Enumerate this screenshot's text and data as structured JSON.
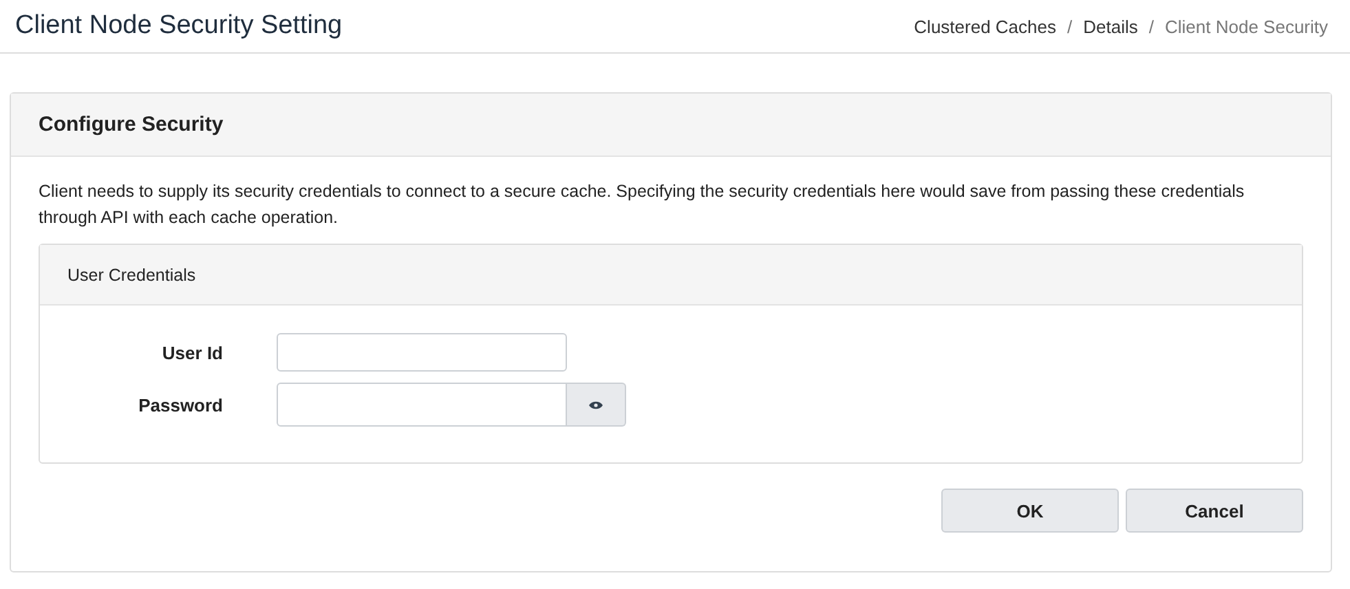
{
  "page_title": "Client Node Security Setting",
  "breadcrumb": [
    {
      "label": "Clustered Caches",
      "current": false
    },
    {
      "label": "Details",
      "current": false
    },
    {
      "label": "Client Node Security",
      "current": true
    }
  ],
  "separator": "/",
  "card": {
    "title": "Configure Security",
    "description": "Client needs to supply its security credentials to connect to a secure cache. Specifying the security credentials here would save from passing these credentials through API with each cache operation.",
    "panel": {
      "title": "User Credentials",
      "fields": [
        {
          "label": "User Id",
          "kind": "text"
        },
        {
          "label": "Password",
          "kind": "password"
        }
      ]
    }
  },
  "buttons": [
    "OK",
    "Cancel"
  ]
}
